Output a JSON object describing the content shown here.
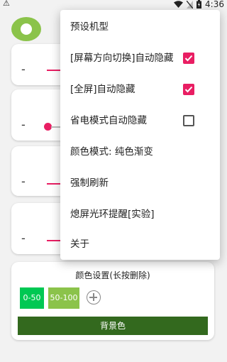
{
  "status_bar": {
    "warning_glyph": "⚠",
    "time": "4:36",
    "icons": [
      "wifi-icon",
      "sim-icon",
      "battery-icon"
    ]
  },
  "menu": {
    "items": [
      {
        "label": "预设机型",
        "checkbox": null
      },
      {
        "label": "[屏幕方向切换]自动隐藏",
        "checkbox": true
      },
      {
        "label": "[全屏]自动隐藏",
        "checkbox": true
      },
      {
        "label": "省电模式自动隐藏",
        "checkbox": false
      },
      {
        "label": "颜色模式: 纯色渐变",
        "checkbox": null
      },
      {
        "label": "强制刷新",
        "checkbox": null
      },
      {
        "label": "熄屏光环提醒[实验]",
        "checkbox": null
      },
      {
        "label": "关于",
        "checkbox": null
      }
    ]
  },
  "background_cards": [
    {
      "minus": "-"
    },
    {
      "minus": "-"
    },
    {
      "minus": "-"
    },
    {
      "minus": "-"
    }
  ],
  "color_settings": {
    "title": "颜色设置(长按删除)",
    "chips": [
      {
        "label": "0-50",
        "color": "#00c853"
      },
      {
        "label": "50-100",
        "color": "#8bc34a"
      }
    ],
    "background_label": "背景色",
    "background_color": "#33691e"
  },
  "colors": {
    "accent": "#e91e63",
    "logo": "#8bc34a"
  }
}
